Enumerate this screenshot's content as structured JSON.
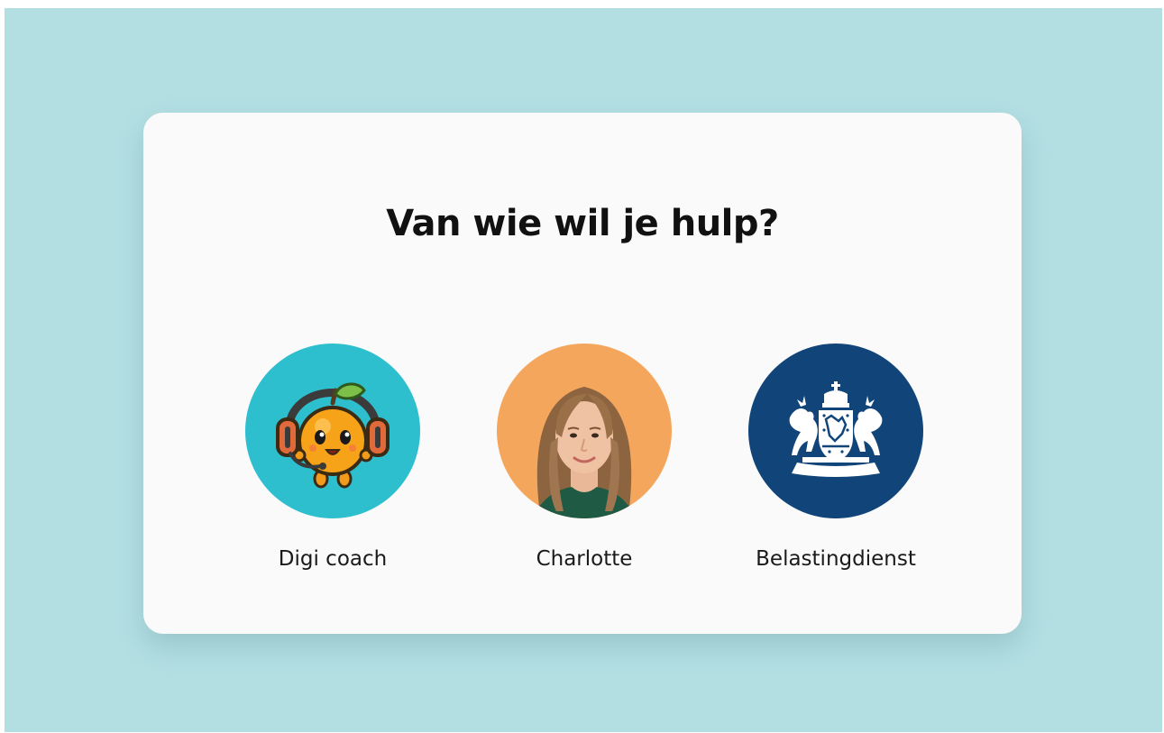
{
  "dialog": {
    "title": "Van wie wil je hulp?"
  },
  "options": [
    {
      "label": "Digi coach",
      "icon": "orange-mascot-headset-avatar",
      "bg": "#2ebfcf"
    },
    {
      "label": "Charlotte",
      "icon": "charlotte-portrait-avatar",
      "bg": "#f4a65c"
    },
    {
      "label": "Belastingdienst",
      "icon": "royal-coat-of-arms-logo",
      "bg": "#11457a"
    }
  ],
  "colors": {
    "page_background": "#b3dfe3",
    "card_background": "#fafafa",
    "title_text": "#111111"
  }
}
